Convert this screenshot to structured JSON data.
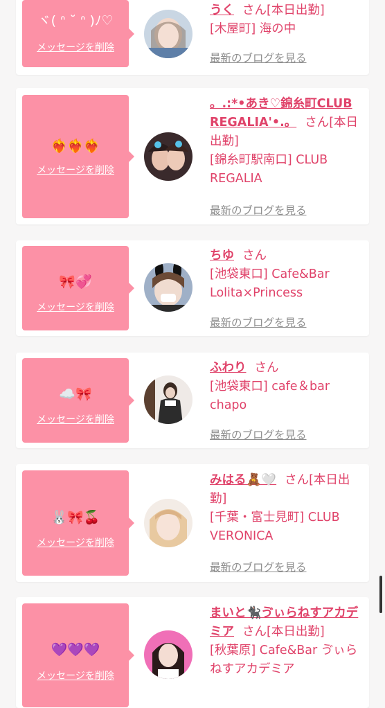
{
  "delete_label": "メッセージを削除",
  "blog_label": "最新のブログを見る",
  "san": "さん",
  "cards": [
    {
      "message": "ヾ( ᐢ ˘ ᐢ )ﾉ♡",
      "name": "うく",
      "suffix": "[本日出勤]",
      "area": "[木屋町]",
      "shop": "海の中"
    },
    {
      "message": "❤️‍🔥❤️‍🔥❤️‍🔥",
      "name": "。.:*•あき♡錦糸町CLUB REGALIA'•.。",
      "suffix": "[本日出勤]",
      "area": "[錦糸町駅南口]",
      "shop": "CLUB REGALIA"
    },
    {
      "message": "🎀💞",
      "name": "ちゆ",
      "suffix": "",
      "area": "[池袋東口]",
      "shop": "Cafe&Bar Lolita×Princess"
    },
    {
      "message": "☁️🎀",
      "name": "ふわり",
      "suffix": "",
      "area": "[池袋東口]",
      "shop": "cafe＆bar chapo"
    },
    {
      "message": "🐰🎀🍒",
      "name": "みはる🧸🤍",
      "suffix": "[本日出勤]",
      "area": "[千葉・富士見町]",
      "shop": "CLUB VERONICA"
    },
    {
      "message": "💜💜💜",
      "name": "まいと🐈‍⬛ゔぃらねすアカデミア",
      "suffix": "[本日出勤]",
      "area": "[秋葉原]",
      "shop": "Cafe&Bar ゔぃらねすアカデミア"
    }
  ],
  "colors": {
    "accent": "#e0436a",
    "message_box": "#fc91a6",
    "link_gray": "#8e8e8e",
    "background": "#f7f6f6"
  }
}
